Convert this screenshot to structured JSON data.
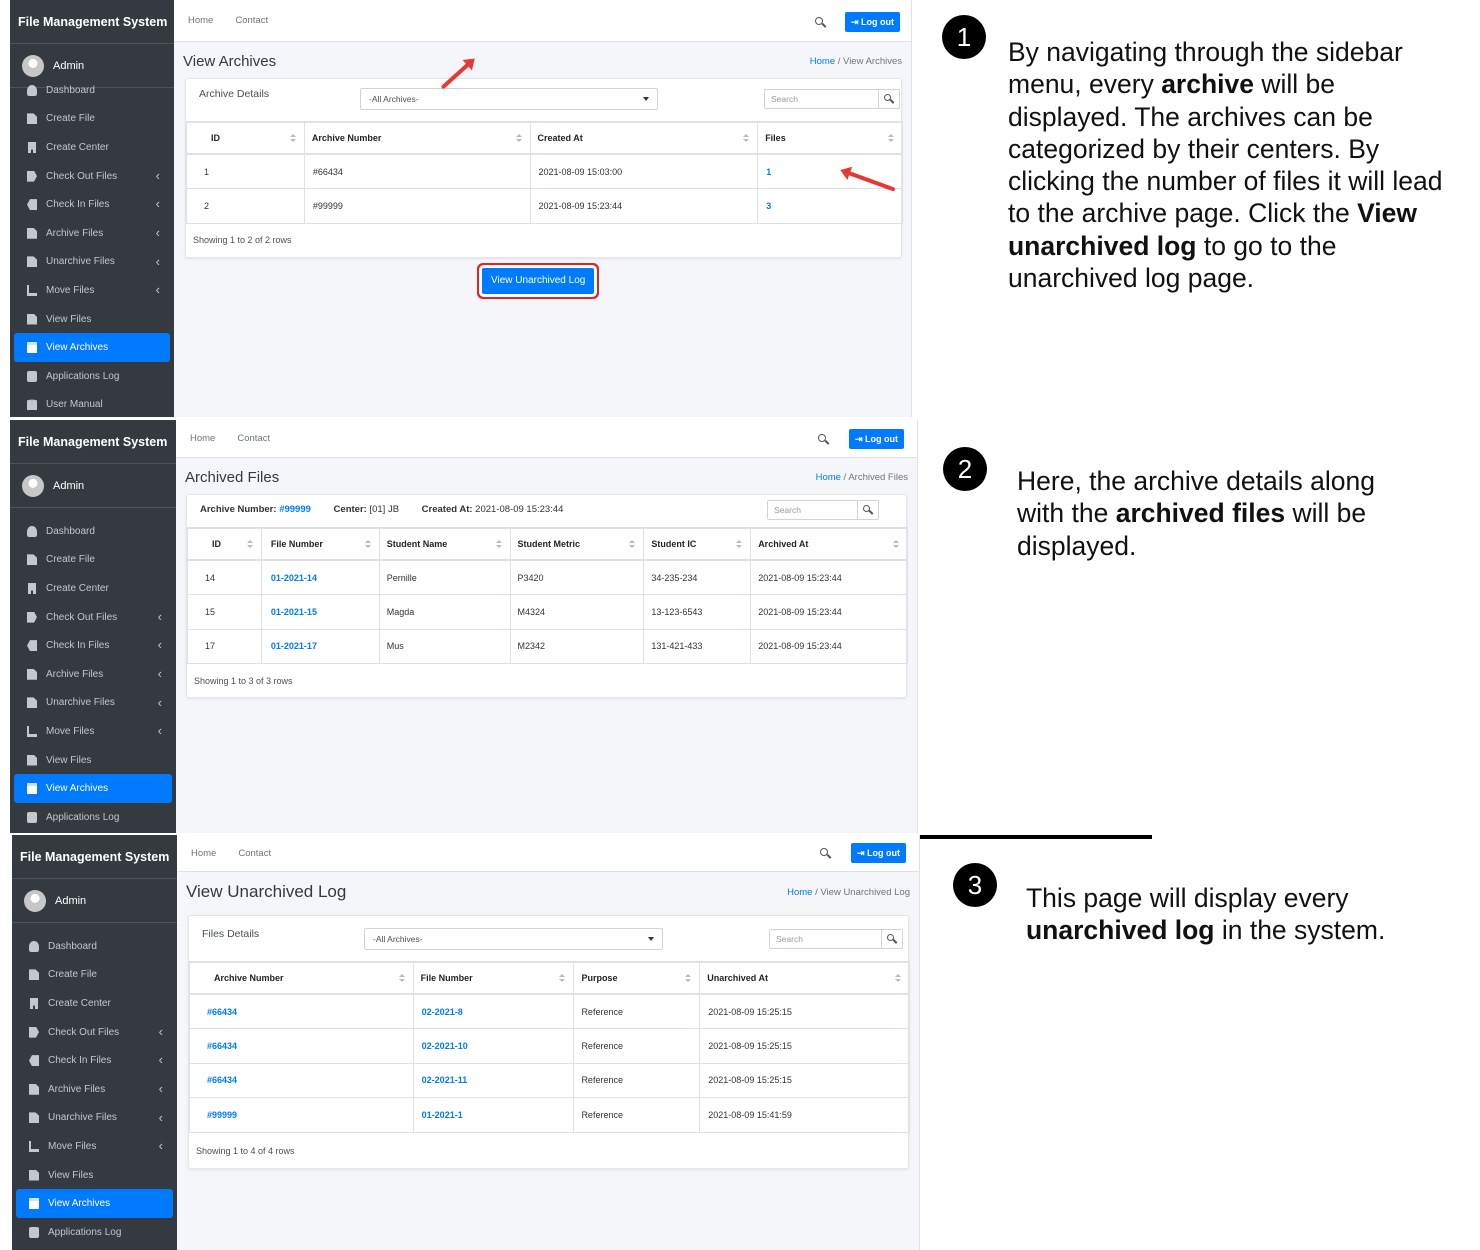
{
  "app": {
    "brand": "File Management System",
    "user": "Admin"
  },
  "nav": {
    "home": "Home",
    "contact": "Contact",
    "logout": "Log out"
  },
  "search_placeholder": "Search",
  "sidebar": {
    "dashboard": "Dashboard",
    "create_file": "Create File",
    "create_center": "Create Center",
    "check_out": "Check Out Files",
    "check_in": "Check In Files",
    "archive": "Archive Files",
    "unarchive": "Unarchive Files",
    "move": "Move Files",
    "view_files": "View Files",
    "view_archives": "View Archives",
    "applog": "Applications Log",
    "manual": "User Manual"
  },
  "p1": {
    "title": "View Archives",
    "bc_current": "View Archives",
    "label": "Archive Details",
    "select": "-All Archives-",
    "headers": [
      "ID",
      "Archive Number",
      "Created At",
      "Files"
    ],
    "rows": [
      [
        "1",
        "#66434",
        "2021-08-09 15:03:00",
        "1"
      ],
      [
        "2",
        "#99999",
        "2021-08-09 15:23:44",
        "3"
      ]
    ],
    "showing": "Showing 1 to 2 of 2 rows",
    "btn": "View Unarchived Log"
  },
  "p2": {
    "title": "Archived Files",
    "bc_current": "Archived Files",
    "an_label": "Archive Number:",
    "an_value": "#99999",
    "center_label": "Center:",
    "center_value": "[01] JB",
    "created_label": "Created At:",
    "created_value": "2021-08-09 15:23:44",
    "headers": [
      "ID",
      "File Number",
      "Student Name",
      "Student Metric",
      "Student IC",
      "Archived At"
    ],
    "rows": [
      [
        "14",
        "01-2021-14",
        "Pernille",
        "P3420",
        "34-235-234",
        "2021-08-09 15:23:44"
      ],
      [
        "15",
        "01-2021-15",
        "Magda",
        "M4324",
        "13-123-6543",
        "2021-08-09 15:23:44"
      ],
      [
        "17",
        "01-2021-17",
        "Mus",
        "M2342",
        "131-421-433",
        "2021-08-09 15:23:44"
      ]
    ],
    "showing": "Showing 1 to 3 of 3 rows"
  },
  "p3": {
    "title": "View Unarchived Log",
    "bc_current": "View Unarchived Log",
    "label": "Files Details",
    "select": "-All Archives-",
    "headers": [
      "Archive Number",
      "File Number",
      "Purpose",
      "Unarchived At"
    ],
    "rows": [
      [
        "#66434",
        "02-2021-8",
        "Reference",
        "2021-08-09 15:25:15"
      ],
      [
        "#66434",
        "02-2021-10",
        "Reference",
        "2021-08-09 15:25:15"
      ],
      [
        "#66434",
        "02-2021-11",
        "Reference",
        "2021-08-09 15:25:15"
      ],
      [
        "#99999",
        "01-2021-1",
        "Reference",
        "2021-08-09 15:41:59"
      ]
    ],
    "showing": "Showing 1 to 4 of 4 rows"
  },
  "steps": {
    "n1": "1",
    "n2": "2",
    "n3": "3",
    "d1": {
      "a": "By navigating through the sidebar menu, every ",
      "b": "archive",
      "c": " will be displayed. The archives can be categorized by their centers. By clicking the number of files it will lead to the archive page. Click the ",
      "d": "View unarchived log",
      "e": " to go to the unarchived log page."
    },
    "d2": {
      "a": "Here, the archive details along with the ",
      "b": "archived files",
      "c": " will be displayed."
    },
    "d3": {
      "a": "This page will display every ",
      "b": "unarchived log",
      "c": " in the system."
    }
  }
}
